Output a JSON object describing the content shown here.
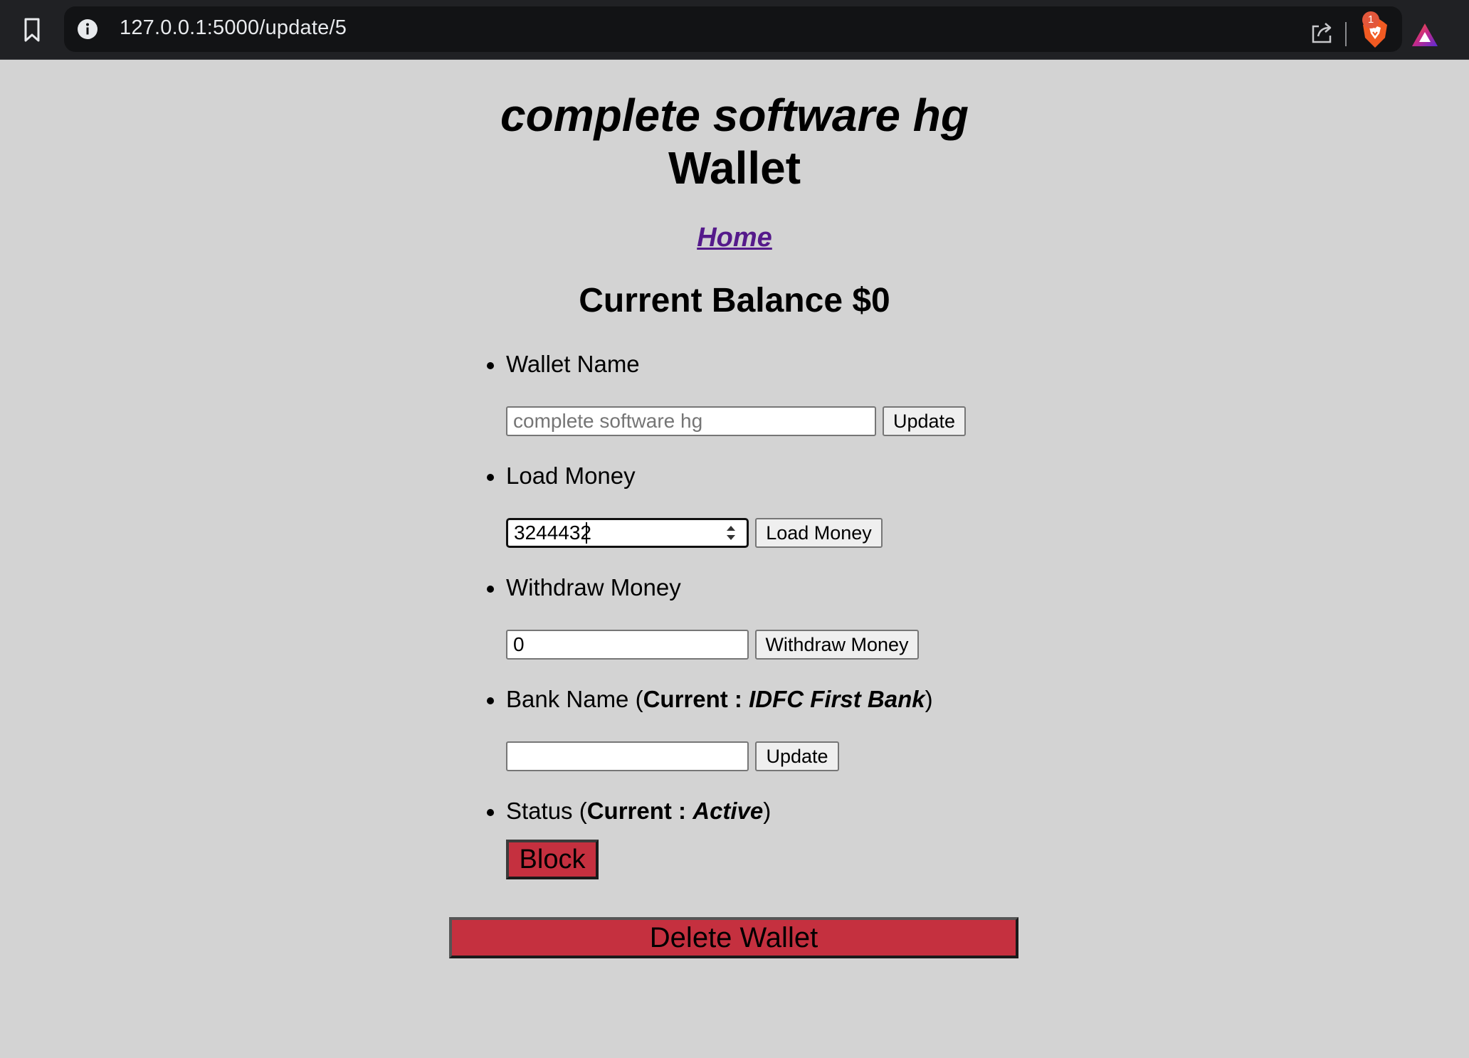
{
  "browser": {
    "url": "127.0.0.1:5000/update/5",
    "rewards_badge": "1"
  },
  "icons": {
    "bookmark": "bookmark-icon",
    "info": "info-icon",
    "share": "share-icon",
    "brave": "brave-shield-icon",
    "rewards": "brave-rewards-icon"
  },
  "header": {
    "wallet_name": "complete software hg",
    "suffix": "Wallet",
    "home_link": "Home"
  },
  "balance": {
    "label": "Current Balance $0"
  },
  "sections": {
    "wallet_name": {
      "label": "Wallet Name",
      "input_placeholder": "complete software hg",
      "button": "Update"
    },
    "load_money": {
      "label": "Load Money",
      "input_value": "3244432",
      "button": "Load Money"
    },
    "withdraw_money": {
      "label": "Withdraw Money",
      "input_value": "0",
      "button": "Withdraw Money"
    },
    "bank_name": {
      "label": "Bank Name (",
      "current_label": "Current :",
      "current_value": "IDFC First Bank",
      "close": ")",
      "input_value": "",
      "button": "Update"
    },
    "status": {
      "label": "Status (",
      "current_label": "Current :",
      "current_value": "Active",
      "close": ")",
      "button": "Block"
    }
  },
  "delete_button": "Delete Wallet",
  "colors": {
    "page_bg": "#d3d3d3",
    "danger": "#c5303f",
    "link": "#551a8b",
    "chrome_bg": "#202124"
  }
}
